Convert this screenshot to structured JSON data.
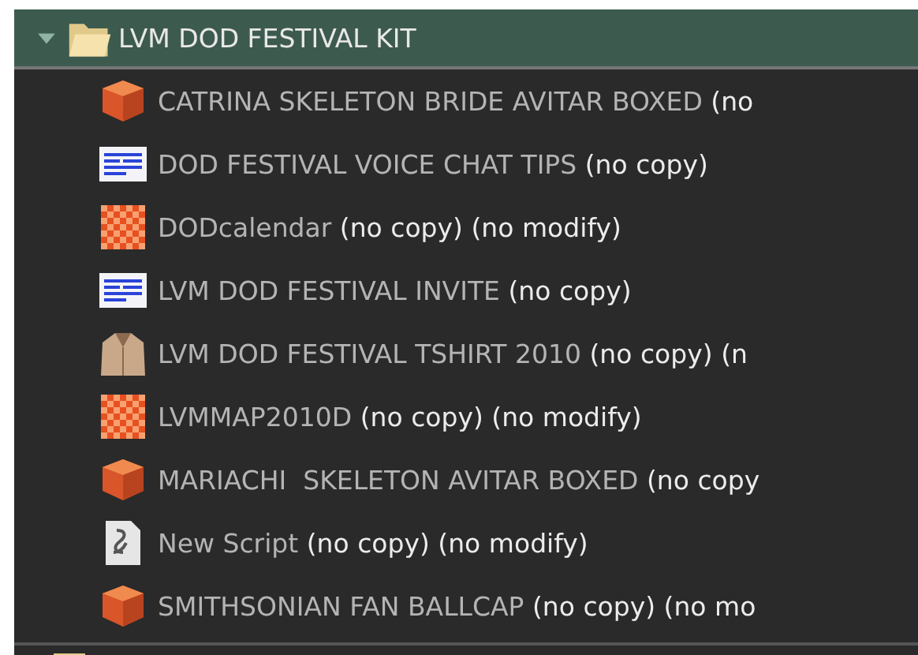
{
  "folder": {
    "name": "LVM DOD FESTIVAL KIT",
    "expanded": true,
    "selected": true
  },
  "items": [
    {
      "kind": "object",
      "name": "CATRINA SKELETON BRIDE AVITAR BOXED",
      "suffix": "(no"
    },
    {
      "kind": "notecard",
      "name": "DOD FESTIVAL VOICE CHAT TIPS",
      "suffix": "(no copy)"
    },
    {
      "kind": "texture",
      "name": "DODcalendar",
      "suffix": "(no copy) (no modify)"
    },
    {
      "kind": "notecard",
      "name": "LVM DOD FESTIVAL INVITE",
      "suffix": "(no copy)"
    },
    {
      "kind": "clothing",
      "name": "LVM DOD FESTIVAL TSHIRT 2010",
      "suffix": "(no copy) (n"
    },
    {
      "kind": "texture",
      "name": "LVMMAP2010D",
      "suffix": "(no copy) (no modify)"
    },
    {
      "kind": "object",
      "name": "MARIACHI  SKELETON AVITAR BOXED",
      "suffix": "(no copy"
    },
    {
      "kind": "script",
      "name": "New Script",
      "suffix": "(no copy) (no modify)"
    },
    {
      "kind": "object",
      "name": "SMITHSONIAN FAN BALLCAP",
      "suffix": "(no copy) (no mo"
    }
  ]
}
